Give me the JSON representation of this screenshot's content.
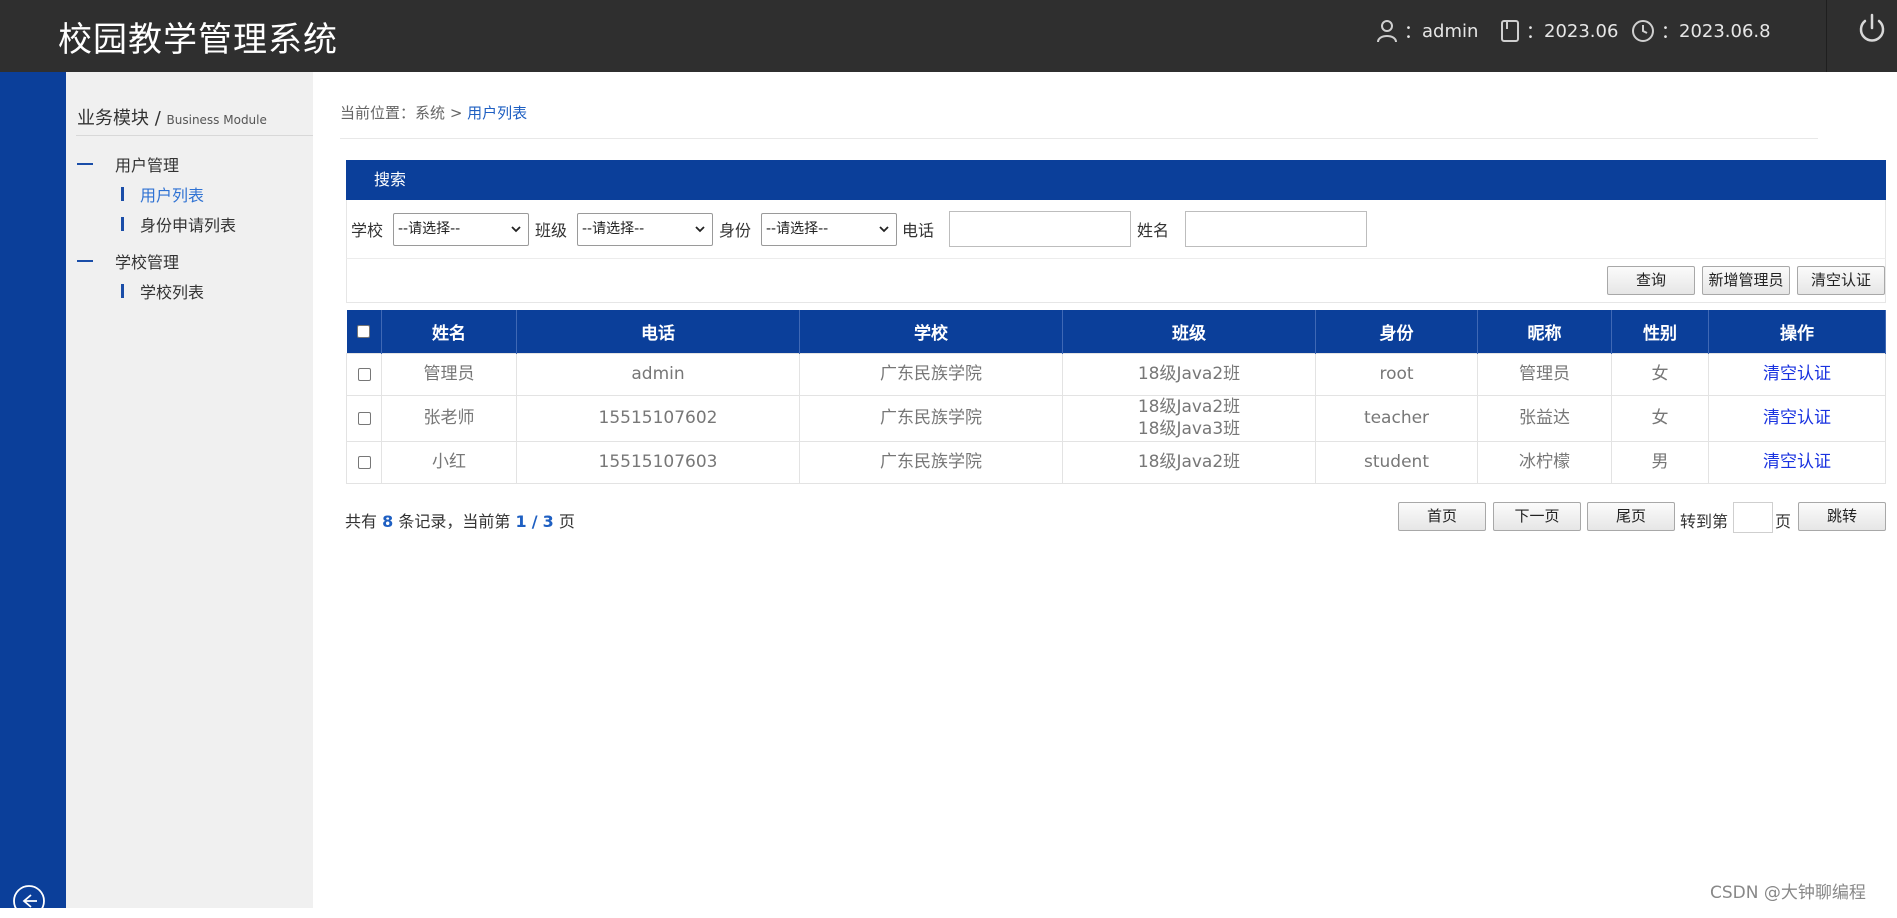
{
  "header": {
    "app_title": "校园教学管理系统",
    "user": "admin",
    "version": "2023.06",
    "date": "2023.06.8",
    "colon": "："
  },
  "sidebar": {
    "module_title": "业务模块",
    "module_sub": "Business Module",
    "groups": [
      {
        "label": "用户管理",
        "items": [
          {
            "label": "用户列表"
          },
          {
            "label": "身份申请列表"
          }
        ]
      },
      {
        "label": "学校管理",
        "items": [
          {
            "label": "学校列表"
          }
        ]
      }
    ]
  },
  "breadcrumb": {
    "prefix": "当前位置：",
    "root": "系统",
    "sep": ">",
    "current": "用户列表"
  },
  "search": {
    "title": "搜索",
    "school_label": "学校",
    "class_label": "班级",
    "identity_label": "身份",
    "phone_label": "电话",
    "name_label": "姓名",
    "school_value": "--请选择--",
    "class_value": "--请选择--",
    "identity_value": "--请选择--",
    "phone_value": "",
    "name_value": ""
  },
  "actions": {
    "query": "查询",
    "add_admin": "新增管理员",
    "clear_auth": "清空认证"
  },
  "table": {
    "headers": [
      "姓名",
      "电话",
      "学校",
      "班级",
      "身份",
      "昵称",
      "性别",
      "操作"
    ],
    "rows": [
      {
        "name": "管理员",
        "phone": "admin",
        "school": "广东民族学院",
        "class1": "18级Java2班",
        "class2": "",
        "identity": "root",
        "nickname": "管理员",
        "gender": "女",
        "op": "清空认证"
      },
      {
        "name": "张老师",
        "phone": "15515107602",
        "school": "广东民族学院",
        "class1": "18级Java2班",
        "class2": "18级Java3班",
        "identity": "teacher",
        "nickname": "张益达",
        "gender": "女",
        "op": "清空认证"
      },
      {
        "name": "小红",
        "phone": "15515107603",
        "school": "广东民族学院",
        "class1": "18级Java2班",
        "class2": "",
        "identity": "student",
        "nickname": "冰柠檬",
        "gender": "男",
        "op": "清空认证"
      }
    ]
  },
  "pager": {
    "t1": "共有",
    "total": "8",
    "t2": "条记录，当前第",
    "current": "1",
    "slash": "/",
    "pages": "3",
    "t3": "页",
    "first": "首页",
    "next": "下一页",
    "last": "尾页",
    "goto_label": "转到第",
    "page_unit": "页",
    "jump": "跳转",
    "goto_value": ""
  },
  "watermark": "CSDN @大钟聊编程",
  "colors": {
    "brand": "#0b3f9a",
    "header_bg": "#2f2f2f",
    "link": "#1a33e0"
  }
}
